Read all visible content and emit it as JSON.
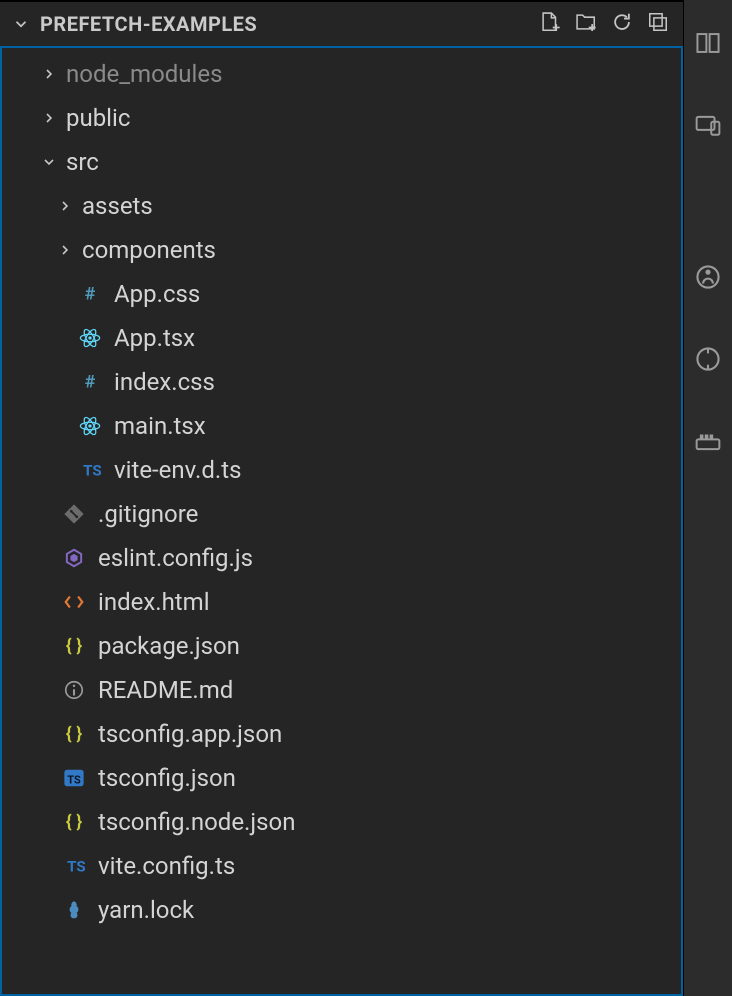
{
  "header": {
    "title": "PREFETCH-EXAMPLES"
  },
  "tree": [
    {
      "type": "folder",
      "state": "closed",
      "indent": 0,
      "name": "node_modules",
      "dim": true
    },
    {
      "type": "folder",
      "state": "closed",
      "indent": 0,
      "name": "public"
    },
    {
      "type": "folder",
      "state": "open",
      "indent": 0,
      "name": "src"
    },
    {
      "type": "folder",
      "state": "closed",
      "indent": 1,
      "name": "assets"
    },
    {
      "type": "folder",
      "state": "closed",
      "indent": 1,
      "name": "components"
    },
    {
      "type": "file",
      "icon": "css",
      "indent": 1,
      "name": "App.css"
    },
    {
      "type": "file",
      "icon": "react",
      "indent": 1,
      "name": "App.tsx"
    },
    {
      "type": "file",
      "icon": "css",
      "indent": 1,
      "name": "index.css"
    },
    {
      "type": "file",
      "icon": "react",
      "indent": 1,
      "name": "main.tsx"
    },
    {
      "type": "file",
      "icon": "ts",
      "indent": 1,
      "name": "vite-env.d.ts"
    },
    {
      "type": "file",
      "icon": "git",
      "indent": 0,
      "name": ".gitignore"
    },
    {
      "type": "file",
      "icon": "eslint",
      "indent": 0,
      "name": "eslint.config.js"
    },
    {
      "type": "file",
      "icon": "html",
      "indent": 0,
      "name": "index.html"
    },
    {
      "type": "file",
      "icon": "json",
      "indent": 0,
      "name": "package.json"
    },
    {
      "type": "file",
      "icon": "info",
      "indent": 0,
      "name": "README.md"
    },
    {
      "type": "file",
      "icon": "json",
      "indent": 0,
      "name": "tsconfig.app.json"
    },
    {
      "type": "file",
      "icon": "tsconfig",
      "indent": 0,
      "name": "tsconfig.json"
    },
    {
      "type": "file",
      "icon": "json",
      "indent": 0,
      "name": "tsconfig.node.json"
    },
    {
      "type": "file",
      "icon": "ts",
      "indent": 0,
      "name": "vite.config.ts"
    },
    {
      "type": "file",
      "icon": "yarn",
      "indent": 0,
      "name": "yarn.lock"
    }
  ],
  "strip_icons": [
    "layout",
    "devices",
    "live",
    "record",
    "container",
    "account"
  ]
}
